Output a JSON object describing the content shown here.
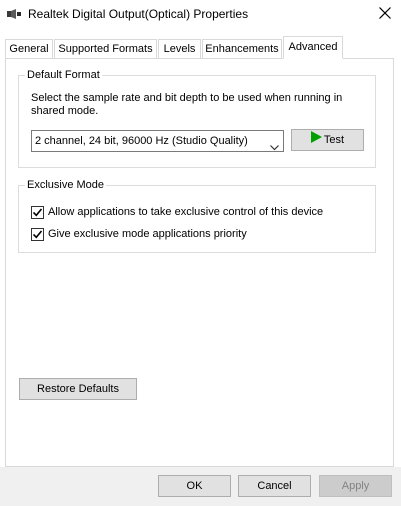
{
  "window": {
    "title": "Realtek Digital Output(Optical) Properties",
    "close_icon": "close-icon"
  },
  "tabs": [
    {
      "label": "General"
    },
    {
      "label": "Supported Formats"
    },
    {
      "label": "Levels"
    },
    {
      "label": "Enhancements"
    },
    {
      "label": "Advanced",
      "active": true
    }
  ],
  "default_format": {
    "heading": "Default Format",
    "description": "Select the sample rate and bit depth to be used when running in shared mode.",
    "selected_format": "2 channel, 24 bit, 96000 Hz (Studio Quality)",
    "test_label": "Test"
  },
  "exclusive_mode": {
    "heading": "Exclusive Mode",
    "options": [
      {
        "label": "Allow applications to take exclusive control of this device",
        "checked": true
      },
      {
        "label": "Give exclusive mode applications priority",
        "checked": true
      }
    ]
  },
  "restore_defaults_label": "Restore Defaults",
  "footer": {
    "ok_label": "OK",
    "cancel_label": "Cancel",
    "apply_label": "Apply"
  },
  "colors": {
    "play_icon": "#00a000"
  }
}
